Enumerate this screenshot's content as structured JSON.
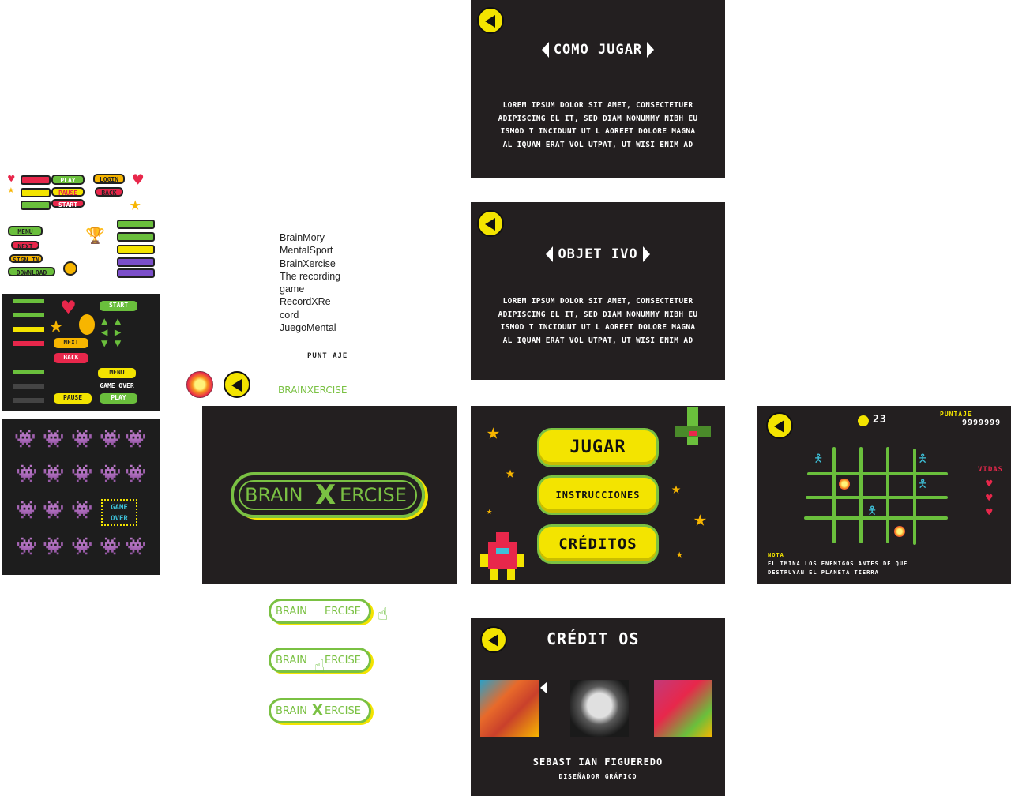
{
  "screens": {
    "how_to_play": {
      "title": "COMO JUGAR",
      "body": [
        "LOREM IPSUM DOLOR SIT AMET, CONSECTETUER",
        "ADIPISCING EL IT, SED DIAM NONUMMY NIBH EU",
        "ISMOD T INCIDUNT UT L AOREET DOLORE MAGNA",
        "AL IQUAM ERAT VOL UTPAT, UT WISI ENIM AD"
      ]
    },
    "objective": {
      "title": "OBJET IVO",
      "body": [
        "LOREM IPSUM DOLOR SIT AMET, CONSECTETUER",
        "ADIPISCING EL IT, SED DIAM NONUMMY NIBH EU",
        "ISMOD T INCIDUNT UT L AOREET DOLORE MAGNA",
        "AL IQUAM ERAT VOL UTPAT, UT WISI ENIM AD"
      ]
    },
    "menu": {
      "play": "JUGAR",
      "instructions": "INSTRUCCIONES",
      "credits": "CRÉDITOS"
    },
    "game": {
      "coins": "23",
      "score_label": "PUNTAJE",
      "score_value": "9999999",
      "lives_label": "VIDAS",
      "note_label": "NOTA",
      "note_line1": "EL IMINA LOS ENEMIGOS ANTES DE QUE",
      "note_line2": "DESTRUYAN EL PLANETA TIERRA"
    },
    "credits": {
      "title": "CRÉDIT OS",
      "person_name": "SEBAST IAN FIGUEREDO",
      "person_role": "DISEÑADOR GRÁFICO"
    },
    "logo_screen": {
      "left": "BRAIN",
      "right": "ERCISE"
    }
  },
  "name_options": [
    "BrainMory",
    "MentalSport",
    "BrainXercise",
    "The recording",
    "game",
    "RecordXRe-",
    "cord",
    "JuegoMental"
  ],
  "labels": {
    "puntaje": "PUNT AJE",
    "brainxercise": "BRAINXERCISE"
  },
  "logo_variants": [
    {
      "left": "BRAIN",
      "right": "ERCISE"
    },
    {
      "left": "BRAIN",
      "right": "ERCISE"
    },
    {
      "left": "BRAIN",
      "right": "ERCISE"
    }
  ],
  "sticker_sheet": {
    "buttons": [
      "PLAY",
      "LOGIN",
      "PAUSE",
      "BACK",
      "START",
      "MENU",
      "NEXT",
      "SIGN IN",
      "DOWNLOAD"
    ],
    "dark_buttons": [
      "START",
      "NEXT",
      "BACK",
      "MENU",
      "GAME OVER",
      "PAUSE",
      "PLAY"
    ],
    "monster_sheet_label": "GAME OVER"
  },
  "colors": {
    "accent_green": "#7ac143",
    "accent_yellow": "#f3e400",
    "screen_bg": "#231f20"
  }
}
